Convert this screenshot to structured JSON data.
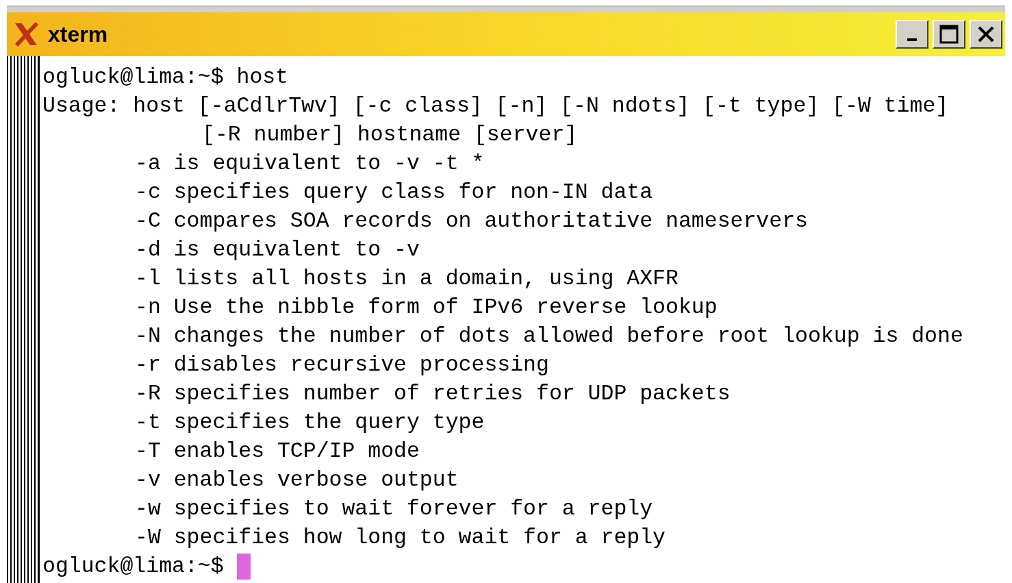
{
  "window": {
    "title": "xterm",
    "buttons": [
      {
        "kind": "minimize"
      },
      {
        "kind": "maximize"
      },
      {
        "kind": "close"
      }
    ]
  },
  "terminal": {
    "lines": [
      {
        "kind": "plain",
        "text": "ogluck@lima:~$ host"
      },
      {
        "kind": "plain",
        "text": "Usage: host [-aCdlrTwv] [-c class] [-n] [-N ndots] [-t type] [-W time]"
      },
      {
        "kind": "continuation",
        "text": "[-R number] hostname [server]"
      },
      {
        "kind": "option",
        "text": "-a is equivalent to -v -t *"
      },
      {
        "kind": "option",
        "text": "-c specifies query class for non-IN data"
      },
      {
        "kind": "option",
        "text": "-C compares SOA records on authoritative nameservers"
      },
      {
        "kind": "option",
        "text": "-d is equivalent to -v"
      },
      {
        "kind": "option",
        "text": "-l lists all hosts in a domain, using AXFR"
      },
      {
        "kind": "option",
        "text": "-n Use the nibble form of IPv6 reverse lookup"
      },
      {
        "kind": "option",
        "text": "-N changes the number of dots allowed before root lookup is done"
      },
      {
        "kind": "option",
        "text": "-r disables recursive processing"
      },
      {
        "kind": "option",
        "text": "-R specifies number of retries for UDP packets"
      },
      {
        "kind": "option",
        "text": "-t specifies the query type"
      },
      {
        "kind": "option",
        "text": "-T enables TCP/IP mode"
      },
      {
        "kind": "option",
        "text": "-v enables verbose output"
      },
      {
        "kind": "option",
        "text": "-w specifies to wait forever for a reply"
      },
      {
        "kind": "option",
        "text": "-W specifies how long to wait for a reply"
      },
      {
        "kind": "plain",
        "text": "ogluck@lima:~$ "
      }
    ],
    "cursor_visible": true
  }
}
